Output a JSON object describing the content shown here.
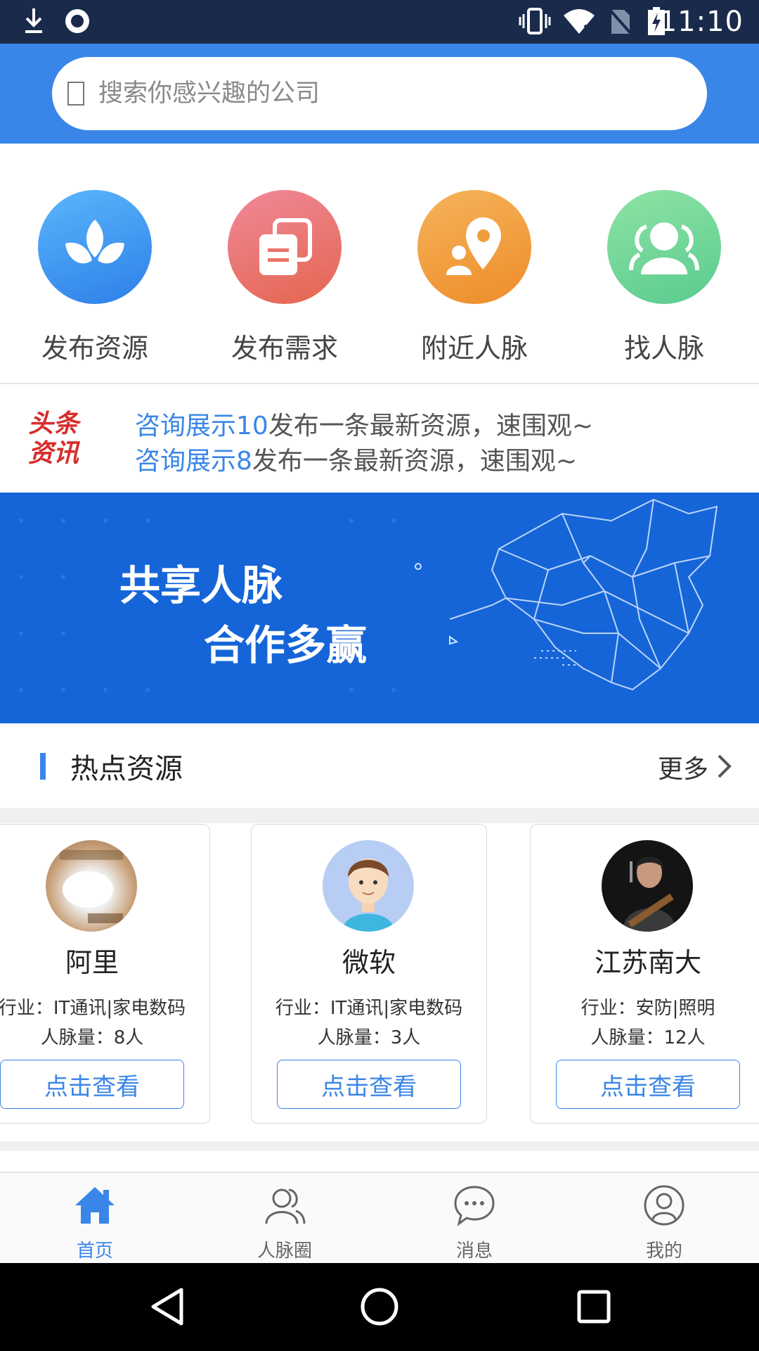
{
  "status_bar": {
    "time": "11:10"
  },
  "search": {
    "placeholder": "搜索你感兴趣的公司"
  },
  "quick_actions": [
    {
      "label": "发布资源",
      "icon": "sprout-icon",
      "color": "#3f95f0"
    },
    {
      "label": "发布需求",
      "icon": "documents-icon",
      "color": "#e9706f"
    },
    {
      "label": "附近人脉",
      "icon": "location-person-icon",
      "color": "#f19a3c"
    },
    {
      "label": "找人脉",
      "icon": "people-icon",
      "color": "#6ed49a"
    }
  ],
  "news": {
    "logo_line1": "头条",
    "logo_line2": "资讯",
    "items": [
      {
        "highlight": "咨询展示10",
        "text": "发布一条最新资源，速围观~"
      },
      {
        "highlight": "咨询展示8",
        "text": "发布一条最新资源，速围观~"
      }
    ]
  },
  "banner": {
    "line1": "共享人脉",
    "line2": "合作多赢"
  },
  "hot": {
    "title": "热点资源",
    "more": "更多"
  },
  "cards": [
    {
      "name": "阿里",
      "industry": "行业：IT通讯|家电数码",
      "count": "人脉量：8人",
      "button": "点击查看"
    },
    {
      "name": "微软",
      "industry": "行业：IT通讯|家电数码",
      "count": "人脉量：3人",
      "button": "点击查看"
    },
    {
      "name": "江苏南大",
      "industry": "行业：安防|照明",
      "count": "人脉量：12人",
      "button": "点击查看"
    }
  ],
  "bottom_nav": [
    {
      "label": "首页",
      "icon": "home-icon",
      "active": true
    },
    {
      "label": "人脉圈",
      "icon": "contacts-icon",
      "active": false
    },
    {
      "label": "消息",
      "icon": "chat-bubble-icon",
      "active": false
    },
    {
      "label": "我的",
      "icon": "profile-icon",
      "active": false
    }
  ],
  "colors": {
    "primary": "#3a86e8",
    "banner": "#1565d8",
    "news_logo": "#d82c2c"
  }
}
